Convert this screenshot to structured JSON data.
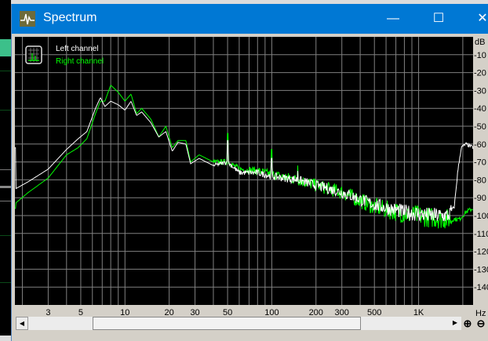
{
  "window": {
    "title": "Spectrum",
    "minimize_icon": "—",
    "maximize_icon": "☐",
    "close_icon": "✕"
  },
  "legend": {
    "left": "Left channel",
    "right": "Right channel"
  },
  "colors": {
    "titlebar": "#0078d4",
    "left": "#ffffff",
    "right": "#00ff00",
    "grid": "#808080",
    "plot_bg": "#000000"
  },
  "scroll": {
    "left_arrow": "◀",
    "right_arrow": "▶",
    "zoom_in": "⊕",
    "zoom_out": "⊖"
  },
  "chart_data": {
    "type": "line",
    "xlabel": "Hz",
    "ylabel": "dB",
    "xscale": "log",
    "xlim": [
      1.78,
      2350
    ],
    "ylim": [
      -150,
      0
    ],
    "x_ticks": [
      {
        "v": 3,
        "label": "3"
      },
      {
        "v": 5,
        "label": "5"
      },
      {
        "v": 10,
        "label": "10"
      },
      {
        "v": 20,
        "label": "20"
      },
      {
        "v": 30,
        "label": "30"
      },
      {
        "v": 50,
        "label": "50"
      },
      {
        "v": 100,
        "label": "100"
      },
      {
        "v": 200,
        "label": "200"
      },
      {
        "v": 300,
        "label": "300"
      },
      {
        "v": 500,
        "label": "500"
      },
      {
        "v": 1000,
        "label": "1K"
      }
    ],
    "y_ticks": [
      -10,
      -20,
      -30,
      -40,
      -50,
      -60,
      -70,
      -80,
      -90,
      -100,
      -110,
      -120,
      -130,
      -140
    ],
    "y_unit_label": "dB",
    "x_unit_label": "Hz",
    "grid": true,
    "legend_position": "top-left",
    "series": [
      {
        "name": "Left channel",
        "points": [
          [
            1.8,
            -85
          ],
          [
            2.2,
            -81
          ],
          [
            3,
            -74
          ],
          [
            4,
            -63
          ],
          [
            4.8,
            -57
          ],
          [
            5.5,
            -53
          ],
          [
            6.3,
            -40
          ],
          [
            6.8,
            -34
          ],
          [
            7.3,
            -39
          ],
          [
            8,
            -36
          ],
          [
            9,
            -38
          ],
          [
            10,
            -41
          ],
          [
            11,
            -36
          ],
          [
            12,
            -44
          ],
          [
            13,
            -42
          ],
          [
            15,
            -48
          ],
          [
            17,
            -56
          ],
          [
            19,
            -53
          ],
          [
            21,
            -64
          ],
          [
            23,
            -59
          ],
          [
            26,
            -60
          ],
          [
            28,
            -71
          ],
          [
            32,
            -68
          ],
          [
            40,
            -72
          ],
          [
            50,
            -70
          ],
          [
            60,
            -76
          ],
          [
            80,
            -76
          ],
          [
            100,
            -78
          ],
          [
            150,
            -80
          ],
          [
            200,
            -83
          ],
          [
            300,
            -87
          ],
          [
            500,
            -94
          ],
          [
            800,
            -98
          ],
          [
            1200,
            -100
          ],
          [
            1600,
            -100
          ],
          [
            1750,
            -95
          ],
          [
            1850,
            -75
          ],
          [
            1950,
            -62
          ],
          [
            2100,
            -60
          ],
          [
            2350,
            -62
          ]
        ]
      },
      {
        "name": "Right channel",
        "points": [
          [
            1.8,
            -93
          ],
          [
            2.2,
            -87
          ],
          [
            3,
            -79
          ],
          [
            4,
            -66
          ],
          [
            4.8,
            -62
          ],
          [
            5.5,
            -57
          ],
          [
            6.3,
            -43
          ],
          [
            6.8,
            -36
          ],
          [
            7.3,
            -36
          ],
          [
            8,
            -27
          ],
          [
            9,
            -31
          ],
          [
            10,
            -36
          ],
          [
            11,
            -32
          ],
          [
            12,
            -43
          ],
          [
            13,
            -40
          ],
          [
            15,
            -46
          ],
          [
            17,
            -56
          ],
          [
            19,
            -50
          ],
          [
            21,
            -62
          ],
          [
            23,
            -58
          ],
          [
            26,
            -58
          ],
          [
            28,
            -70
          ],
          [
            32,
            -66
          ],
          [
            40,
            -70
          ],
          [
            50,
            -70
          ],
          [
            60,
            -74
          ],
          [
            80,
            -75
          ],
          [
            100,
            -77
          ],
          [
            150,
            -80
          ],
          [
            200,
            -83
          ],
          [
            300,
            -87
          ],
          [
            500,
            -95
          ],
          [
            800,
            -99
          ],
          [
            1200,
            -101
          ],
          [
            1600,
            -102
          ],
          [
            1900,
            -102
          ],
          [
            2100,
            -98
          ],
          [
            2350,
            -96
          ]
        ]
      }
    ],
    "peaks": [
      {
        "freq": 50,
        "left": -58,
        "right": -54
      },
      {
        "freq": 100,
        "left": -68,
        "right": -63
      },
      {
        "freq": 150,
        "left": -75,
        "right": -72
      }
    ]
  }
}
